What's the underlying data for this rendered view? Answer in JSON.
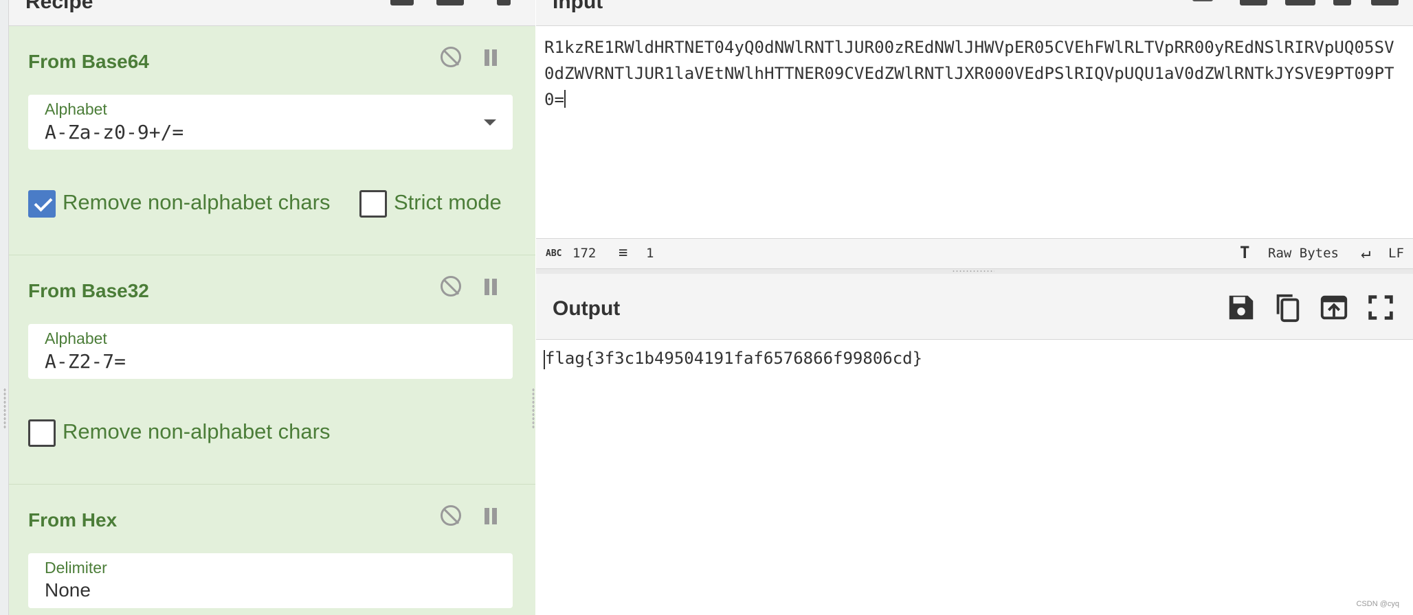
{
  "recipe": {
    "title": "Recipe",
    "operations": [
      {
        "name": "From Base64",
        "field_label": "Alphabet",
        "field_value": "A-Za-z0-9+/=",
        "checkboxes": [
          {
            "label": "Remove non-alphabet chars",
            "checked": true
          },
          {
            "label": "Strict mode",
            "checked": false
          }
        ]
      },
      {
        "name": "From Base32",
        "field_label": "Alphabet",
        "field_value": "A-Z2-7=",
        "checkboxes": [
          {
            "label": "Remove non-alphabet chars",
            "checked": false
          }
        ]
      },
      {
        "name": "From Hex",
        "field_label": "Delimiter",
        "field_value": "None"
      }
    ]
  },
  "input": {
    "title": "Input",
    "text": "R1kzRE1RWldHRTNET04yQ0dNWlRNTlJUR00zREdNWlJHWVpER05CVEhFWlRLTVpRR00yREdNSlRIRVpUQ05SV0dZWVRNTlJUR1laVEtNWlhHTTNER09CVEdZWlRNTlJXR000VEdPSlRIQVpUQU1aV0dZWlRNTkJYSVE9PT09PT0="
  },
  "status": {
    "length": "172",
    "lines": "1",
    "encoding": "Raw Bytes",
    "eol": "LF"
  },
  "output": {
    "title": "Output",
    "text": "flag{3f3c1b49504191faf6576866f99806cd}"
  },
  "watermark": "CSDN @cyq",
  "colors": {
    "op_bg": "#e3f0db",
    "op_text": "#4b7d38",
    "checkbox_on": "#4a7cc7"
  },
  "icons": [
    "disable-icon",
    "pause-icon",
    "dropdown-icon",
    "save-icon",
    "copy-icon",
    "replace-input-icon",
    "maximize-icon",
    "text-length-icon",
    "lines-icon",
    "font-icon",
    "eol-icon"
  ]
}
